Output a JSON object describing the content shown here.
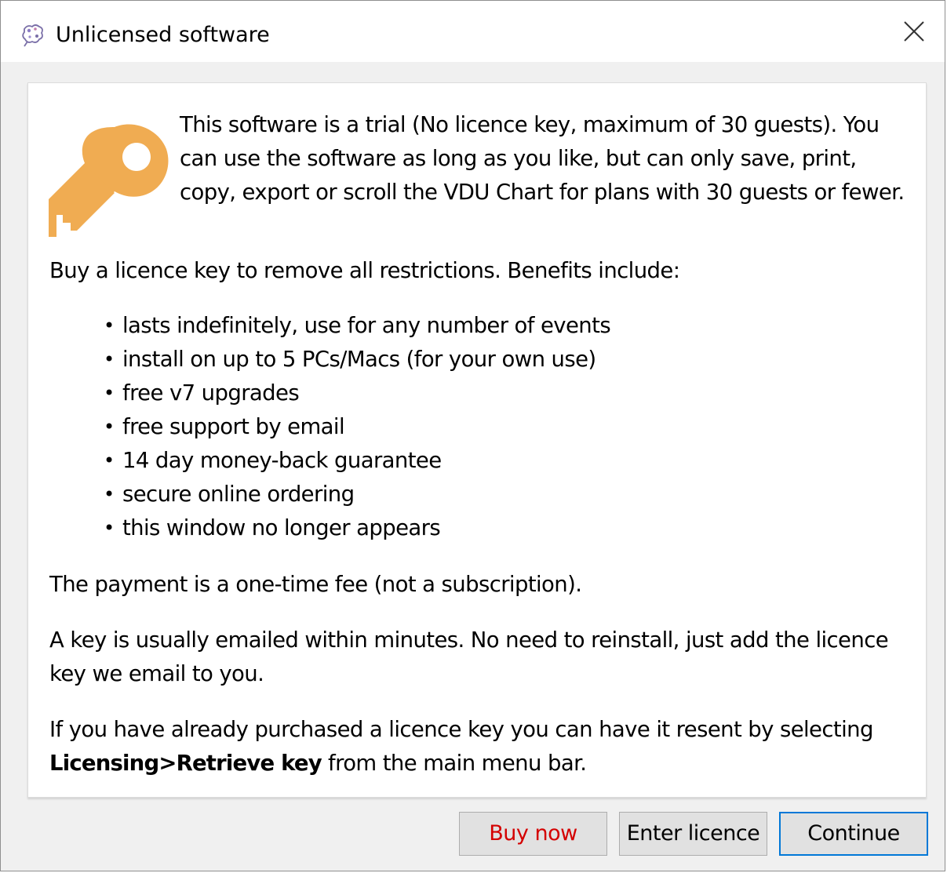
{
  "window": {
    "title": "Unlicensed software",
    "close_label": "Close"
  },
  "icons": {
    "title_icon": "app-icon",
    "key_icon": "key-icon",
    "close_icon": "close-icon",
    "key_color": "#f0ac52"
  },
  "content": {
    "intro": "This software is a trial (No licence key, maximum of 30 guests). You can use the software as long as you like, but can only save, print, copy, export or scroll the VDU Chart for plans with 30 guests or fewer.",
    "buy_line": "Buy a licence key to remove all restrictions. Benefits include:",
    "benefits": [
      "lasts indefinitely, use for any number of events",
      "install on up to 5 PCs/Macs (for your own use)",
      "free v7 upgrades",
      "free support by email",
      "14 day money-back guarantee",
      "secure online ordering",
      "this window no longer appears"
    ],
    "payment": "The payment is a one-time fee (not a subscription).",
    "email_para": "A key is usually emailed within minutes. No need to reinstall, just add the licence key we email to you.",
    "purchased_prefix": "If you have already purchased a licence key you can have it resent by selecting ",
    "purchased_bold": "Licensing>Retrieve key",
    "purchased_suffix": " from the main menu bar."
  },
  "buttons": {
    "buy_now": "Buy now",
    "enter_licence": "Enter licence",
    "continue": "Continue"
  },
  "colors": {
    "buy_now_text": "#d40000",
    "continue_border": "#0078d7"
  }
}
